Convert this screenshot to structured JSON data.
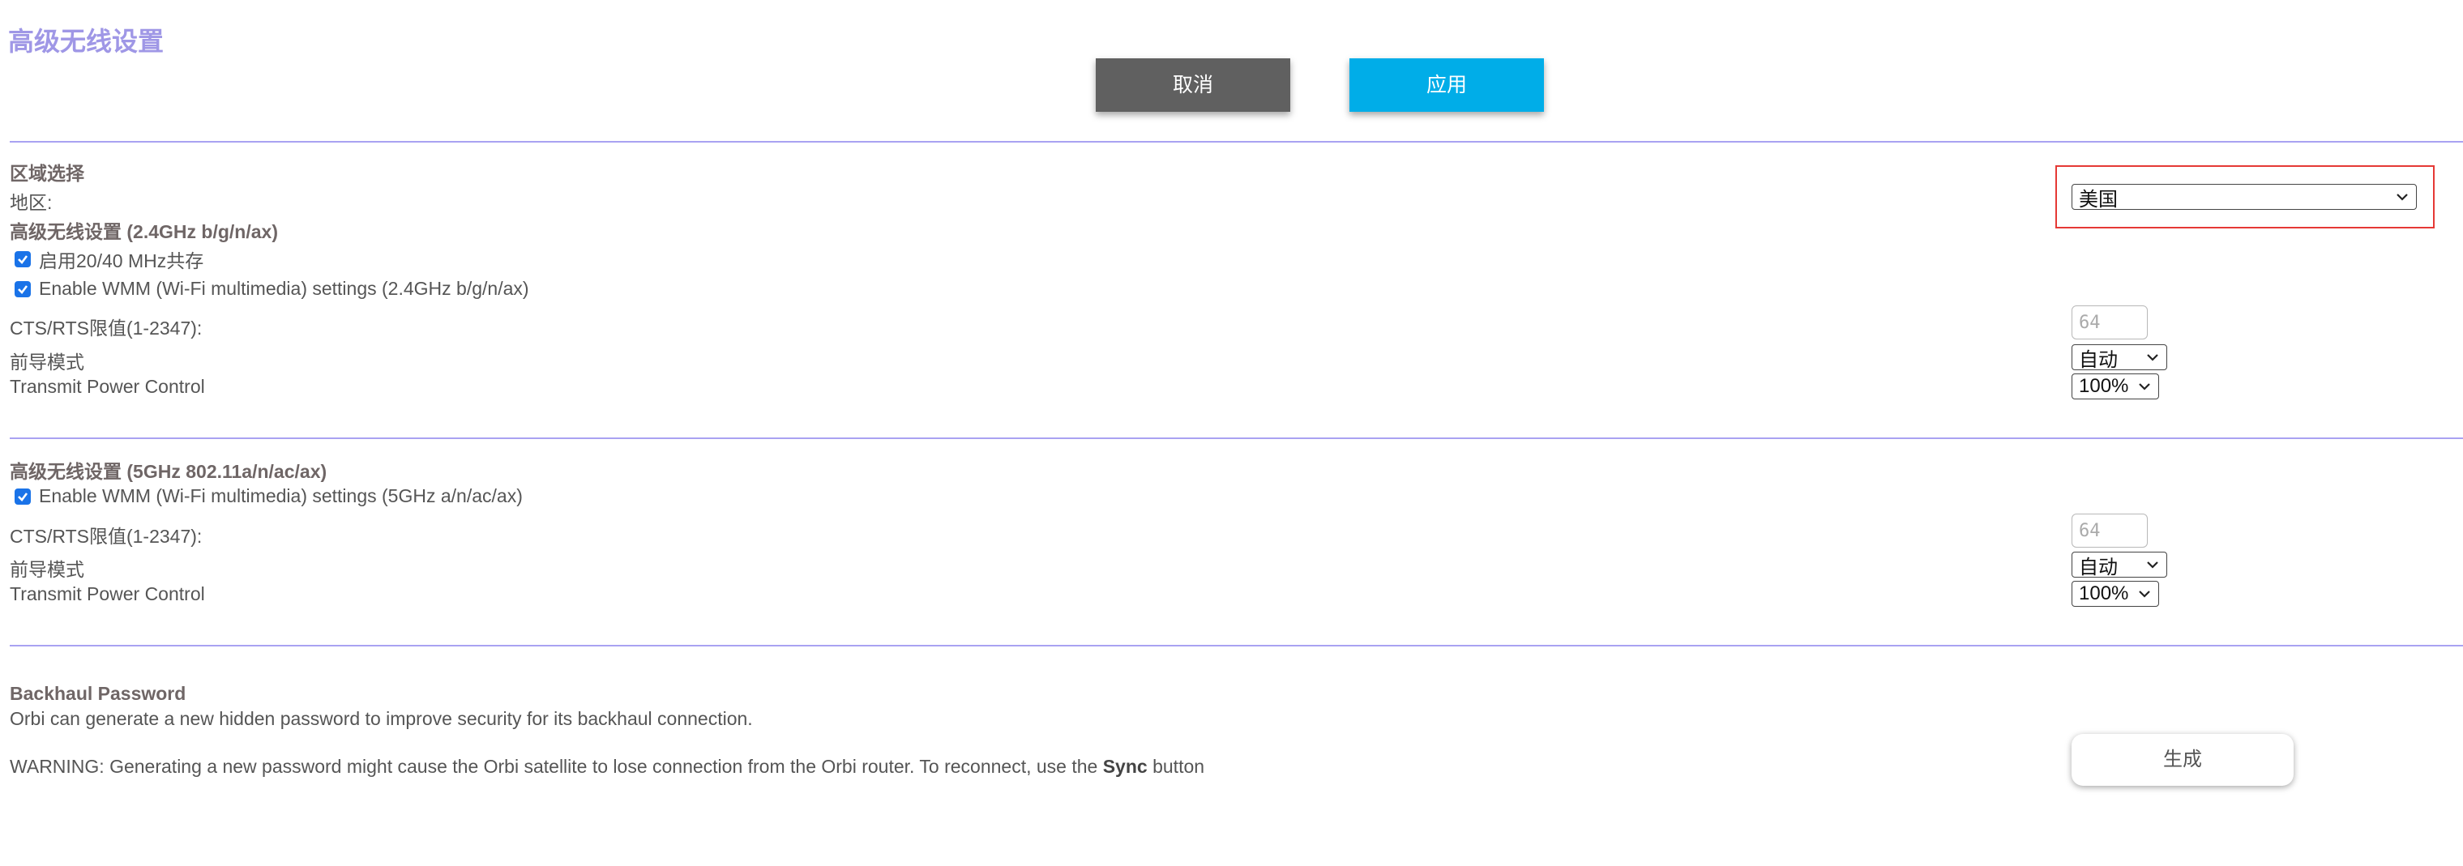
{
  "header": {
    "title": "高级无线设置",
    "cancel_label": "取消",
    "apply_label": "应用"
  },
  "region": {
    "section_title": "区域选择",
    "label": "地区:",
    "selected": "美国"
  },
  "wireless_24": {
    "section_title": "高级无线设置 (2.4GHz b/g/n/ax)",
    "coexist_label": "启用20/40 MHz共存",
    "coexist_checked": true,
    "wmm_label": "Enable WMM (Wi-Fi multimedia) settings (2.4GHz b/g/n/ax)",
    "wmm_checked": true,
    "cts_label": "CTS/RTS限值(1-2347):",
    "cts_value": "64",
    "preamble_label": "前导模式",
    "preamble_selected": "自动",
    "power_label": "Transmit Power Control",
    "power_selected": "100%"
  },
  "wireless_5": {
    "section_title": "高级无线设置 (5GHz 802.11a/n/ac/ax)",
    "wmm_label": "Enable WMM (Wi-Fi multimedia) settings (5GHz a/n/ac/ax)",
    "wmm_checked": true,
    "cts_label": "CTS/RTS限值(1-2347):",
    "cts_value": "64",
    "preamble_label": "前导模式",
    "preamble_selected": "自动",
    "power_label": "Transmit Power Control",
    "power_selected": "100%"
  },
  "backhaul": {
    "title": "Backhaul Password",
    "description": "Orbi can generate a new hidden password to improve security for its backhaul connection.",
    "warning_prefix": "WARNING: Generating a new password might cause the Orbi satellite to lose connection from the Orbi router. To reconnect, use the",
    "warning_bold": "Sync",
    "warning_suffix": "button",
    "generate_label": "生成"
  },
  "colors": {
    "title_color": "#9f97e6",
    "cancel_bg": "#606060",
    "apply_bg": "#00ade8",
    "divider": "#a9a2f2",
    "highlight_border": "#e53935",
    "checkbox": "#1a73e8"
  },
  "icons": {
    "dropdown": "chevron-down-icon",
    "checkbox": "check-icon"
  }
}
